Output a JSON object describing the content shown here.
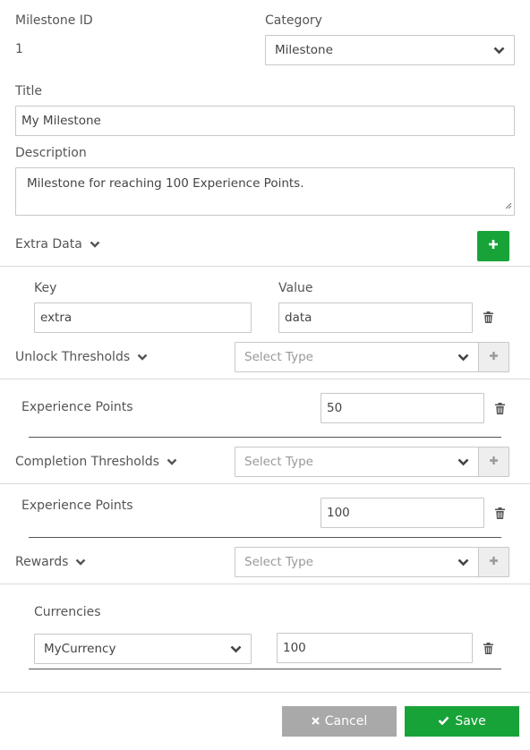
{
  "milestone": {
    "id_label": "Milestone ID",
    "id_value": "1",
    "category_label": "Category",
    "category_value": "Milestone",
    "title_label": "Title",
    "title_value": "My Milestone",
    "description_label": "Description",
    "description_value": "Milestone for reaching 100 Experience Points."
  },
  "extra_data": {
    "label": "Extra Data",
    "key_label": "Key",
    "value_label": "Value",
    "rows": [
      {
        "key": "extra",
        "value": "data"
      }
    ]
  },
  "unlock_thresholds": {
    "label": "Unlock Thresholds",
    "select_placeholder": "Select Type",
    "rows": [
      {
        "name": "Experience Points",
        "value": "50"
      }
    ]
  },
  "completion_thresholds": {
    "label": "Completion Thresholds",
    "select_placeholder": "Select Type",
    "rows": [
      {
        "name": "Experience Points",
        "value": "100"
      }
    ]
  },
  "rewards": {
    "label": "Rewards",
    "select_placeholder": "Select Type",
    "currencies_label": "Currencies",
    "currency_rows": [
      {
        "currency": "MyCurrency",
        "amount": "100"
      }
    ]
  },
  "footer": {
    "cancel_label": "Cancel",
    "save_label": "Save"
  },
  "colors": {
    "accent_green": "#18a339",
    "cancel_gray": "#a9a9a9",
    "border": "#c8c8c8",
    "text": "#555555",
    "placeholder": "#999999"
  }
}
